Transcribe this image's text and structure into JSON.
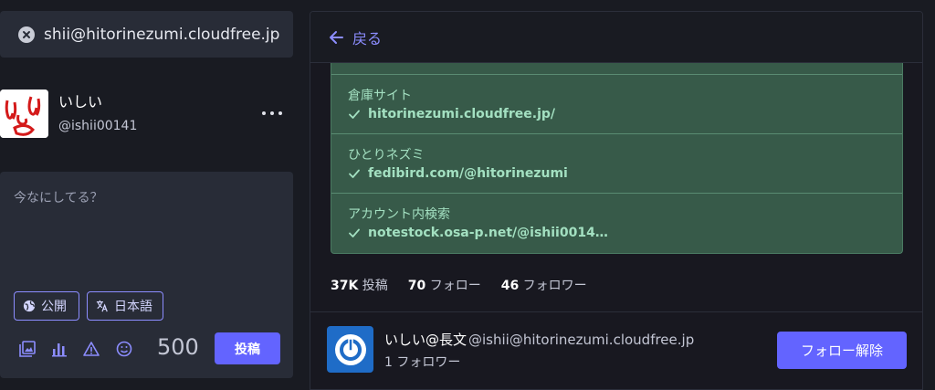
{
  "search": {
    "value": "shii@hitorinezumi.cloudfree.jp"
  },
  "profile": {
    "display_name": "いしい",
    "handle": "@ishii00141"
  },
  "compose": {
    "placeholder": "今なにしてる？",
    "visibility_label": "公開",
    "language_label": "日本語",
    "char_count": "500",
    "post_label": "投稿"
  },
  "header": {
    "back_label": "戻る"
  },
  "fields": [
    {
      "name": "倉庫サイト",
      "value": "hitorinezumi.cloudfree.jp/"
    },
    {
      "name": "ひとりネズミ",
      "value": "fedibird.com/@hitorinezumi"
    },
    {
      "name": "アカウント内検索",
      "value": "notestock.osa-p.net/@ishii0014…"
    }
  ],
  "stats": {
    "posts_count": "37K",
    "posts_label": "投稿",
    "following_count": "70",
    "following_label": "フォロー",
    "followers_count": "46",
    "followers_label": "フォロワー"
  },
  "featured": {
    "name": "いしい@長文",
    "acct": "@ishii@hitorinezumi.cloudfree.jp",
    "followers": "1 フォロワー",
    "unfollow_label": "フォロー解除"
  },
  "colors": {
    "accent": "#6364ff",
    "verified_bg": "#375a49",
    "verified_text": "#a3e0c1",
    "background": "#191b22"
  }
}
